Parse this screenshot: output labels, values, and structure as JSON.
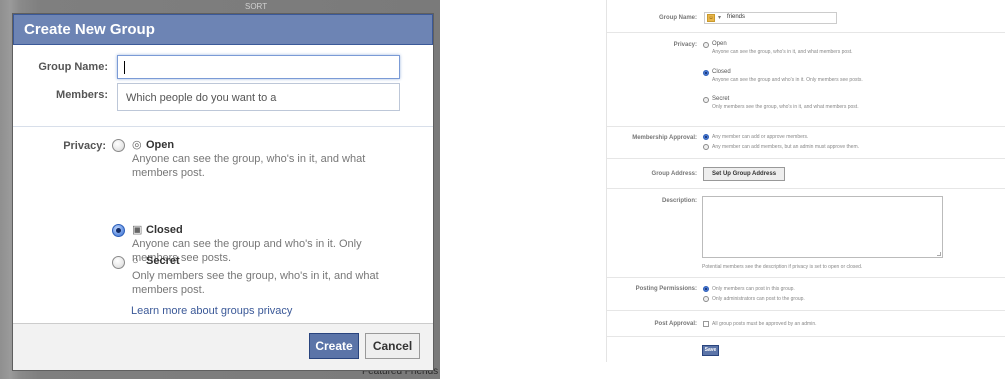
{
  "left": {
    "background": {
      "top_text": "SORT",
      "bottom_text": "Featured Friends"
    },
    "dialog": {
      "title": "Create New Group",
      "group_name_label": "Group Name:",
      "group_name_value": "",
      "members_label": "Members:",
      "members_placeholder": "Which people do you want to a",
      "privacy_label": "Privacy:",
      "options": [
        {
          "title": "Open",
          "icon": "globe-icon",
          "glyph": "◎",
          "checked": false,
          "description": "Anyone can see the group, who's in it, and what members post."
        },
        {
          "title": "Closed",
          "icon": "lock-icon",
          "glyph": "▣",
          "checked": true,
          "description": "Anyone can see the group and who's in it. Only members see posts."
        },
        {
          "title": "Secret",
          "icon": "secret-icon",
          "glyph": "○",
          "checked": false,
          "description": "Only members see the group, who's in it, and what members post."
        }
      ],
      "learn_more": "Learn more about groups privacy",
      "create_label": "Create",
      "cancel_label": "Cancel"
    }
  },
  "right": {
    "group_name_label": "Group Name:",
    "group_name_value": "friends",
    "privacy_label": "Privacy:",
    "privacy_options": [
      {
        "title": "Open",
        "description": "Anyone can see the group, who's in it, and what members post.",
        "checked": false
      },
      {
        "title": "Closed",
        "description": "Anyone can see the group and who's in it. Only members see posts.",
        "checked": true
      },
      {
        "title": "Secret",
        "description": "Only members see the group, who's in it, and what members post.",
        "checked": false
      }
    ],
    "membership_label": "Membership Approval:",
    "membership_options": [
      {
        "label": "Any member can add or approve members.",
        "checked": true
      },
      {
        "label": "Any member can add members, but an admin must approve them.",
        "checked": false
      }
    ],
    "address_label": "Group Address:",
    "address_button": "Set Up Group Address",
    "description_label": "Description:",
    "description_hint": "Potential members see the description if privacy is set to open or closed.",
    "posting_label": "Posting Permissions:",
    "posting_options": [
      {
        "label": "Only members can post in this group.",
        "checked": true
      },
      {
        "label": "Only administrators can post to the group.",
        "checked": false
      }
    ],
    "approval_label": "Post Approval:",
    "approval_checkbox": "All group posts must be approved by an admin.",
    "save_label": "Save"
  },
  "colors": {
    "header_blue": "#6d84b4",
    "button_blue": "#5b74a8",
    "link_blue": "#3b5998"
  }
}
